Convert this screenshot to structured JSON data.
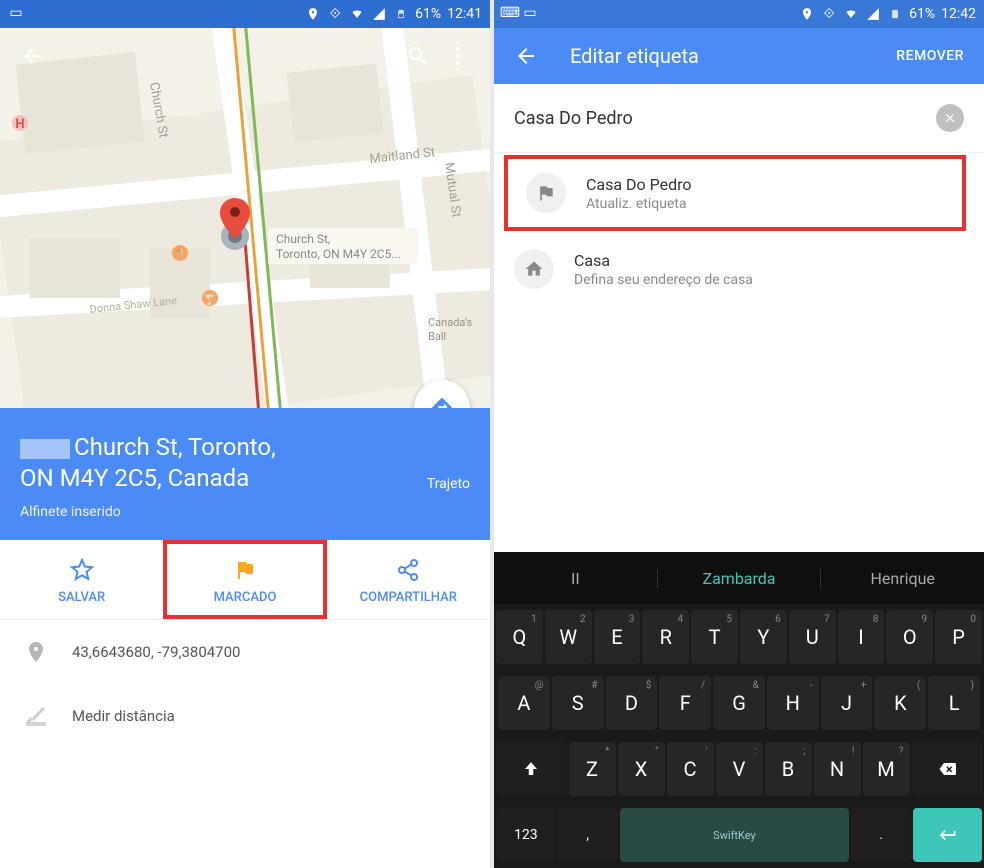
{
  "phone1": {
    "status": {
      "battery": "61%",
      "time": "12:41"
    },
    "map": {
      "streets": [
        "Church St",
        "Maitland St",
        "Mutual St",
        "Donna Shaw Lane"
      ],
      "callout": [
        "Church St,",
        "Toronto, ON M4Y 2C5..."
      ],
      "canadas_ball": "Canada's Ball"
    },
    "address": {
      "line1": "Church St, Toronto,",
      "line2": "ON M4Y 2C5, Canada",
      "trajeto": "Trajeto",
      "pin_status": "Alfinete inserido"
    },
    "actions": {
      "save": "SALVAR",
      "marked": "MARCADO",
      "share": "COMPARTILHAR"
    },
    "details": {
      "coords": "43,6643680, -79,3804700",
      "distance": "Medir distância"
    }
  },
  "phone2": {
    "status": {
      "battery": "61%",
      "time": "12:42"
    },
    "header": {
      "title": "Editar etiqueta",
      "remove": "REMOVER"
    },
    "input": {
      "value": "Casa Do Pedro"
    },
    "suggestions": [
      {
        "title": "Casa Do Pedro",
        "sub": "Atualiz. etiqueta",
        "icon": "flag"
      },
      {
        "title": "Casa",
        "sub": "Defina seu endereço de casa",
        "icon": "home"
      }
    ],
    "keyboard": {
      "suggestions": [
        "II",
        "Zambarda",
        "Henrique"
      ],
      "row1": [
        {
          "k": "Q",
          "a": "1"
        },
        {
          "k": "W",
          "a": "2"
        },
        {
          "k": "E",
          "a": "3"
        },
        {
          "k": "R",
          "a": "4"
        },
        {
          "k": "T",
          "a": "5"
        },
        {
          "k": "Y",
          "a": "6"
        },
        {
          "k": "U",
          "a": "7"
        },
        {
          "k": "I",
          "a": "8"
        },
        {
          "k": "O",
          "a": "9"
        },
        {
          "k": "P",
          "a": "0"
        }
      ],
      "row2": [
        {
          "k": "A",
          "a": "@"
        },
        {
          "k": "S",
          "a": "#"
        },
        {
          "k": "D",
          "a": "$"
        },
        {
          "k": "F",
          "a": "/"
        },
        {
          "k": "G",
          "a": "&"
        },
        {
          "k": "H",
          "a": "-"
        },
        {
          "k": "J",
          "a": "+"
        },
        {
          "k": "K",
          "a": "("
        },
        {
          "k": "L",
          "a": ")"
        }
      ],
      "row3": [
        {
          "k": "Z",
          "a": "*"
        },
        {
          "k": "X",
          "a": "\""
        },
        {
          "k": "C",
          "a": "'"
        },
        {
          "k": "V",
          "a": ":"
        },
        {
          "k": "B",
          "a": ";"
        },
        {
          "k": "N",
          "a": "!"
        },
        {
          "k": "M",
          "a": "?"
        }
      ],
      "sym": "123",
      "comma": ",",
      "brand": "SwiftKey"
    }
  }
}
